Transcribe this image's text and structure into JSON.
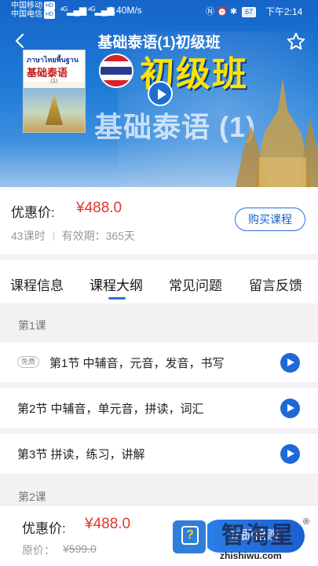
{
  "status_bar": {
    "carrier1": "中国移动",
    "carrier2": "中国电信",
    "hd": "HD",
    "speed": "1.40M/s",
    "battery": "67",
    "time": "下午2:14"
  },
  "header": {
    "title": "基础泰语(1)初级班"
  },
  "cover": {
    "book_thai": "ภาษาไทยพื้นฐาน",
    "book_title": "基础泰语",
    "book_volume": "（1）",
    "level": "初级班",
    "course_name": "基础泰语 (1)"
  },
  "price_card": {
    "label": "优惠价:",
    "price": "¥488.0",
    "lessons": "43课时",
    "validity": "有效期：365天",
    "buy_button": "购买课程"
  },
  "tabs": [
    {
      "label": "课程信息"
    },
    {
      "label": "课程大纲"
    },
    {
      "label": "常见问题"
    },
    {
      "label": "留言反馈"
    }
  ],
  "outline": {
    "section1": "第1课",
    "free_tag": "免费",
    "lessons": [
      {
        "title": "第1节 中辅音，元音，发音，书写"
      },
      {
        "title": "第2节 中辅音，单元音，拼读，词汇"
      },
      {
        "title": "第3节 拼读，练习，讲解"
      }
    ],
    "section2": "第2课"
  },
  "bottom_bar": {
    "label": "优惠价:",
    "price": "¥488.0",
    "original_label": "原价：",
    "original_price": "¥599.0",
    "buy_now": "立即抢购"
  },
  "watermark": {
    "brand": "智淘星",
    "reg": "®",
    "url": "zhishiwu.com"
  },
  "colors": {
    "accent": "#1f68d6",
    "price": "#e2362f"
  }
}
